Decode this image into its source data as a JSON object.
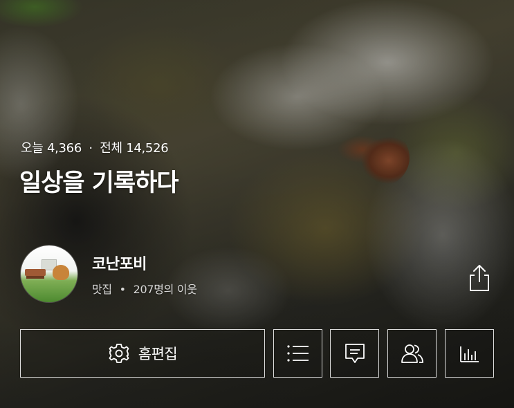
{
  "stats": {
    "today_label": "오늘",
    "today_count": "4,366",
    "separator": "·",
    "total_label": "전체",
    "total_count": "14,526"
  },
  "blog": {
    "title": "일상을 기록하다"
  },
  "profile": {
    "nickname": "코난포비",
    "category": "맛집",
    "separator": "•",
    "neighbors": "207명의 이웃"
  },
  "actions": {
    "edit_home_label": "홈편집",
    "edit_icon": "gear-icon",
    "list_icon": "list-icon",
    "comment_icon": "comment-icon",
    "neighbors_icon": "people-icon",
    "stats_icon": "bar-chart-icon",
    "share_icon": "share-icon"
  },
  "colors": {
    "text": "#ffffff",
    "button_border": "#ffffff"
  }
}
